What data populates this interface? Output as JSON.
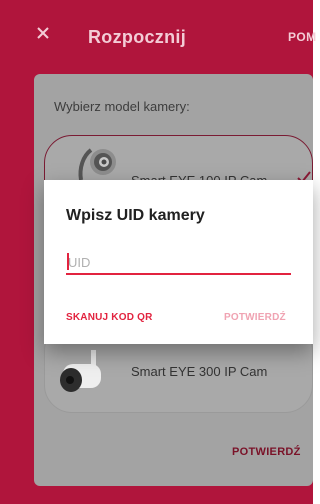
{
  "header": {
    "title": "Rozpocznij",
    "help_label": "POM",
    "close_icon": "close-icon"
  },
  "panel": {
    "heading": "Wybierz model kamery:",
    "cameras": [
      {
        "name": "Smart EYE 100 IP Cam",
        "selected": true,
        "icon": "camera-ball-icon"
      },
      {
        "name": "Smart EYE 300 IP Cam",
        "selected": false,
        "icon": "camera-bullet-icon"
      }
    ],
    "confirm_label": "POTWIERDŹ"
  },
  "dialog": {
    "title": "Wpisz UID kamery",
    "uid_input": {
      "value": "",
      "placeholder": "UID"
    },
    "scan_label": "SKANUJ KOD QR",
    "confirm_label": "POTWIERDŹ"
  },
  "colors": {
    "brand": "#b0153c",
    "accent": "#e2233f",
    "accent_disabled": "#f0a3b2"
  }
}
